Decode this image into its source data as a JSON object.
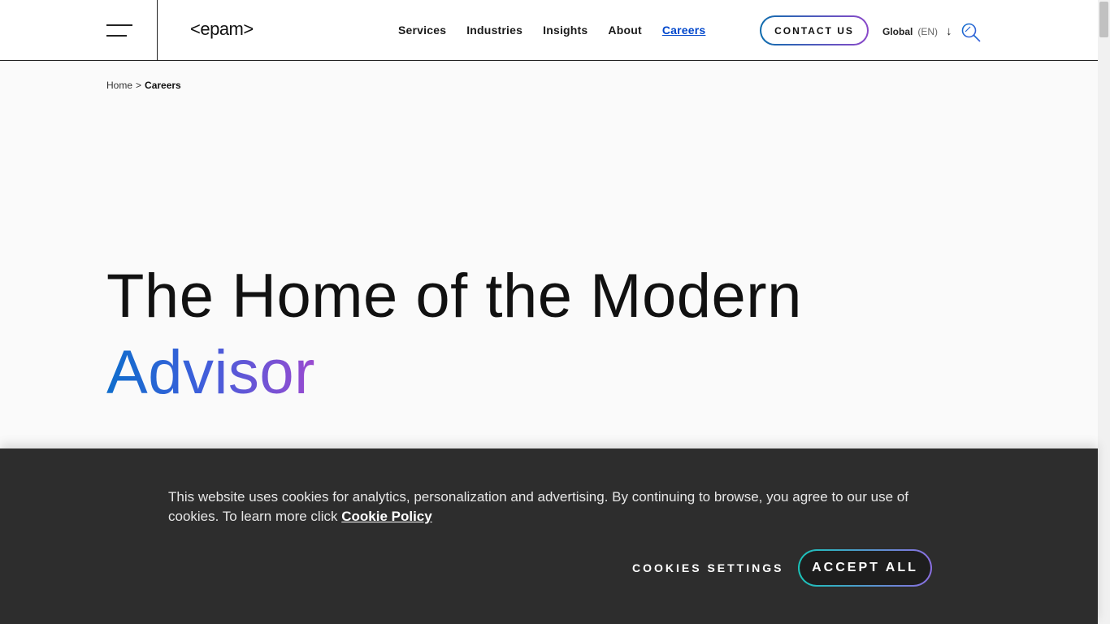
{
  "header": {
    "logo": "<epam>",
    "nav": [
      "Services",
      "Industries",
      "Insights",
      "About",
      "Careers"
    ],
    "active_nav": "Careers",
    "contact_label": "CONTACT US",
    "language": {
      "region": "Global",
      "code": "(EN)"
    },
    "icons": {
      "menu": "hamburger-menu-icon",
      "lang_arrow": "arrow-down-icon",
      "search": "search-icon"
    }
  },
  "breadcrumb": {
    "home": "Home",
    "separator": ">",
    "current": "Careers"
  },
  "hero": {
    "line1": "The Home of the Modern",
    "line2": "Advisor"
  },
  "cookie": {
    "text": "This website uses cookies for analytics, personalization and advertising. By continuing to browse, you agree to our use of cookies. To learn more click",
    "link": "Cookie Policy",
    "settings_label": "COOKIES SETTINGS",
    "accept_label": "ACCEPT ALL"
  },
  "colors": {
    "accent": "#0047cc",
    "gradient_start": "#0f6dcc",
    "gradient_end": "#9a4ad0",
    "banner_bg": "#2d2d2d"
  }
}
